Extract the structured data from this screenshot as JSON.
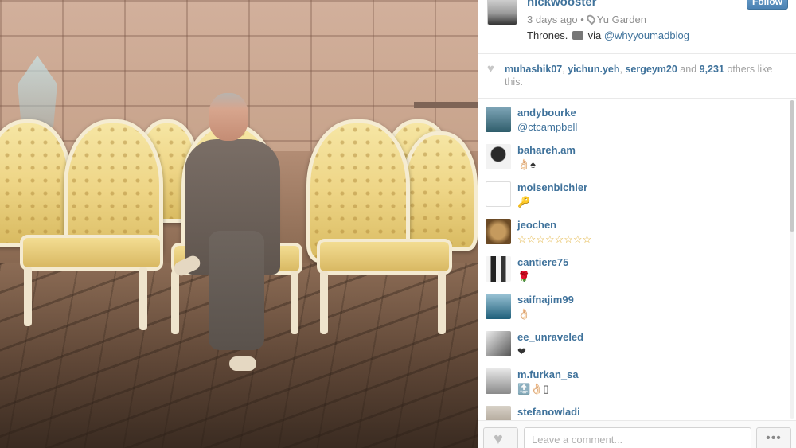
{
  "post": {
    "username": "nickwooster",
    "time_ago": "3 days ago",
    "location": "Yu Garden",
    "caption_text": "Thrones.",
    "caption_via": "via",
    "caption_mention": "@whyyoumadblog",
    "follow_label": "Follow"
  },
  "likes": {
    "users": [
      "muhashik07",
      "yichun.yeh",
      "sergeym20"
    ],
    "and_text": "and",
    "count": "9,231",
    "others_text": "others like this."
  },
  "comments": [
    {
      "user": "andybourke",
      "text": "@ctcampbell",
      "mention": true
    },
    {
      "user": "bahareh.am",
      "text": "👌🏻♠",
      "mention": false
    },
    {
      "user": "moisenbichler",
      "text": "🔑",
      "mention": false
    },
    {
      "user": "jeochen",
      "text": "☆☆☆☆☆☆☆☆",
      "mention": false
    },
    {
      "user": "cantiere75",
      "text": "🌹",
      "mention": false
    },
    {
      "user": "saifnajim99",
      "text": "👌🏻",
      "mention": false
    },
    {
      "user": "ee_unraveled",
      "text": "❤",
      "mention": false
    },
    {
      "user": "m.furkan_sa",
      "text": "🔝👌🏻▯",
      "mention": false
    },
    {
      "user": "stefanowladi",
      "text": "",
      "mention": false
    }
  ],
  "comment_box": {
    "placeholder": "Leave a comment..."
  },
  "more_label": "•••",
  "scrollbar": {
    "position_fraction": 0
  },
  "colors": {
    "link": "#3f729b",
    "follow_button": "#4b82b3"
  },
  "icons": [
    "heart-icon",
    "location-pin-icon",
    "camera-icon",
    "more-icon"
  ]
}
